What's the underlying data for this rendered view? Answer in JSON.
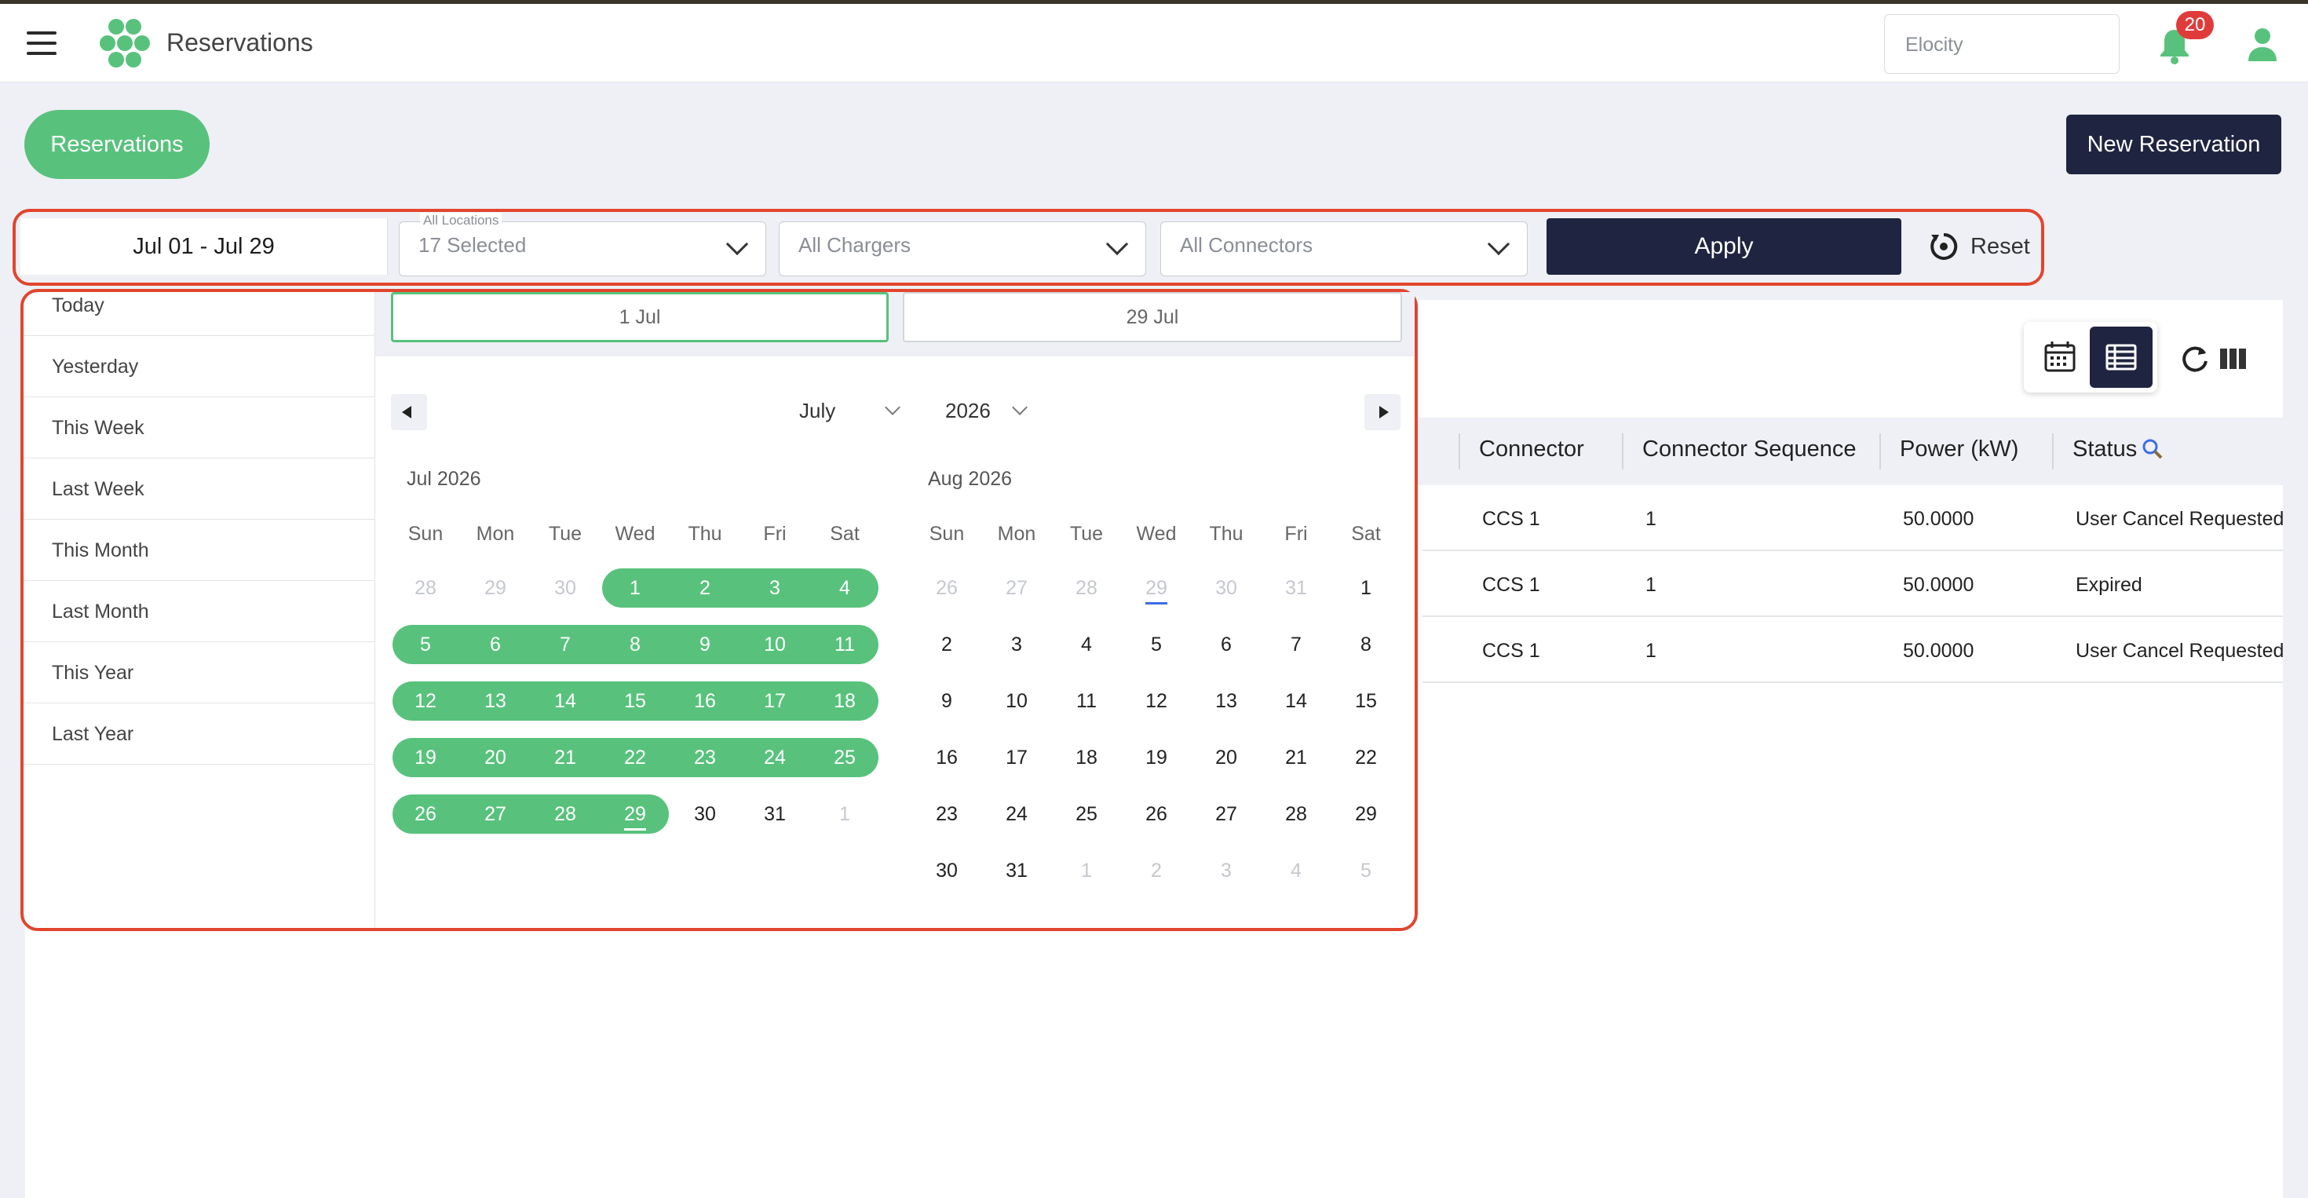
{
  "header": {
    "title": "Reservations",
    "tenant_placeholder": "Elocity",
    "notification_count": "20"
  },
  "page": {
    "tab_label": "Reservations",
    "new_button": "New Reservation"
  },
  "filters": {
    "date_range": "Jul 01 - Jul 29",
    "locations_caption": "All Locations",
    "locations_value": "17 Selected",
    "chargers": "All Chargers",
    "connectors": "All Connectors",
    "apply": "Apply",
    "reset": "Reset"
  },
  "picker": {
    "presets": [
      "Today",
      "Yesterday",
      "This Week",
      "Last Week",
      "This Month",
      "Last Month",
      "This Year",
      "Last Year"
    ],
    "start": "1 Jul",
    "end": "29 Jul",
    "month_select": "July",
    "year_select": "2026",
    "weekdays": [
      "Sun",
      "Mon",
      "Tue",
      "Wed",
      "Thu",
      "Fri",
      "Sat"
    ],
    "months": [
      {
        "title": "Jul 2026",
        "weeks": [
          [
            "28",
            "29",
            "30",
            "1",
            "2",
            "3",
            "4"
          ],
          [
            "5",
            "6",
            "7",
            "8",
            "9",
            "10",
            "11"
          ],
          [
            "12",
            "13",
            "14",
            "15",
            "16",
            "17",
            "18"
          ],
          [
            "19",
            "20",
            "21",
            "22",
            "23",
            "24",
            "25"
          ],
          [
            "26",
            "27",
            "28",
            "29",
            "30",
            "31",
            "1"
          ]
        ]
      },
      {
        "title": "Aug 2026",
        "weeks": [
          [
            "26",
            "27",
            "28",
            "29",
            "30",
            "31",
            "1"
          ],
          [
            "2",
            "3",
            "4",
            "5",
            "6",
            "7",
            "8"
          ],
          [
            "9",
            "10",
            "11",
            "12",
            "13",
            "14",
            "15"
          ],
          [
            "16",
            "17",
            "18",
            "19",
            "20",
            "21",
            "22"
          ],
          [
            "23",
            "24",
            "25",
            "26",
            "27",
            "28",
            "29"
          ],
          [
            "30",
            "31",
            "1",
            "2",
            "3",
            "4",
            "5"
          ]
        ]
      }
    ]
  },
  "table": {
    "columns": [
      "Connector",
      "Connector Sequence",
      "Power (kW)",
      "Status"
    ],
    "rows": [
      [
        "CCS 1",
        "1",
        "50.0000",
        "User Cancel Requested"
      ],
      [
        "CCS 1",
        "1",
        "50.0000",
        "Expired"
      ],
      [
        "CCS 1",
        "1",
        "50.0000",
        "User Cancel Requested"
      ]
    ]
  },
  "colors": {
    "accent": "#58c27c",
    "navy": "#1f2540",
    "highlight": "#e2452e",
    "badge": "#e03b3b"
  }
}
